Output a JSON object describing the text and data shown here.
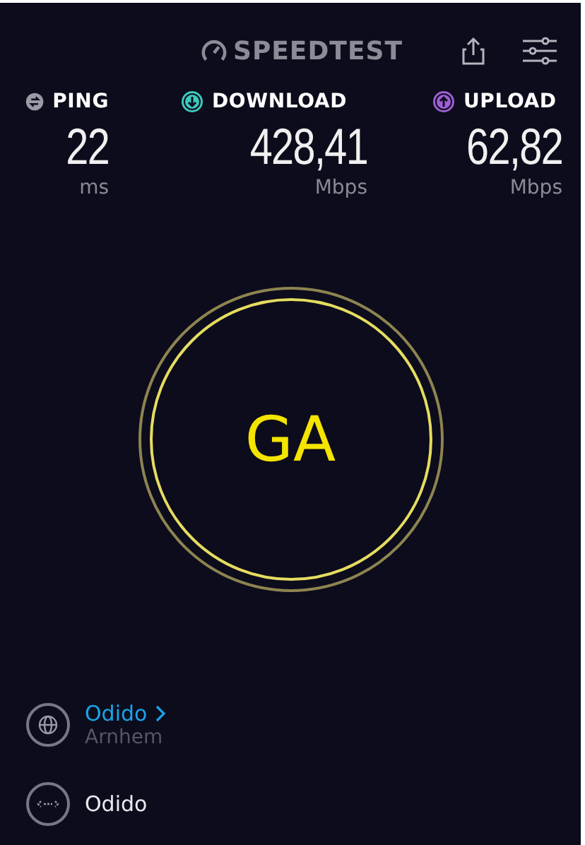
{
  "header": {
    "logo": "SPEEDTEST"
  },
  "stats": [
    {
      "kind": "ping",
      "label": "PING",
      "value": "22",
      "unit": "ms",
      "color": "#9a9aa6"
    },
    {
      "kind": "download",
      "label": "DOWNLOAD",
      "value": "428,41",
      "unit": "Mbps",
      "color": "#3cc9bd"
    },
    {
      "kind": "upload",
      "label": "UPLOAD",
      "value": "62,82",
      "unit": "Mbps",
      "color": "#a05ed6"
    }
  ],
  "go_button": {
    "label": "GA"
  },
  "servers": [
    {
      "kind": "isp",
      "name": "Odido",
      "location": "Arnhem"
    },
    {
      "kind": "connection",
      "name": "Odido"
    }
  ]
}
